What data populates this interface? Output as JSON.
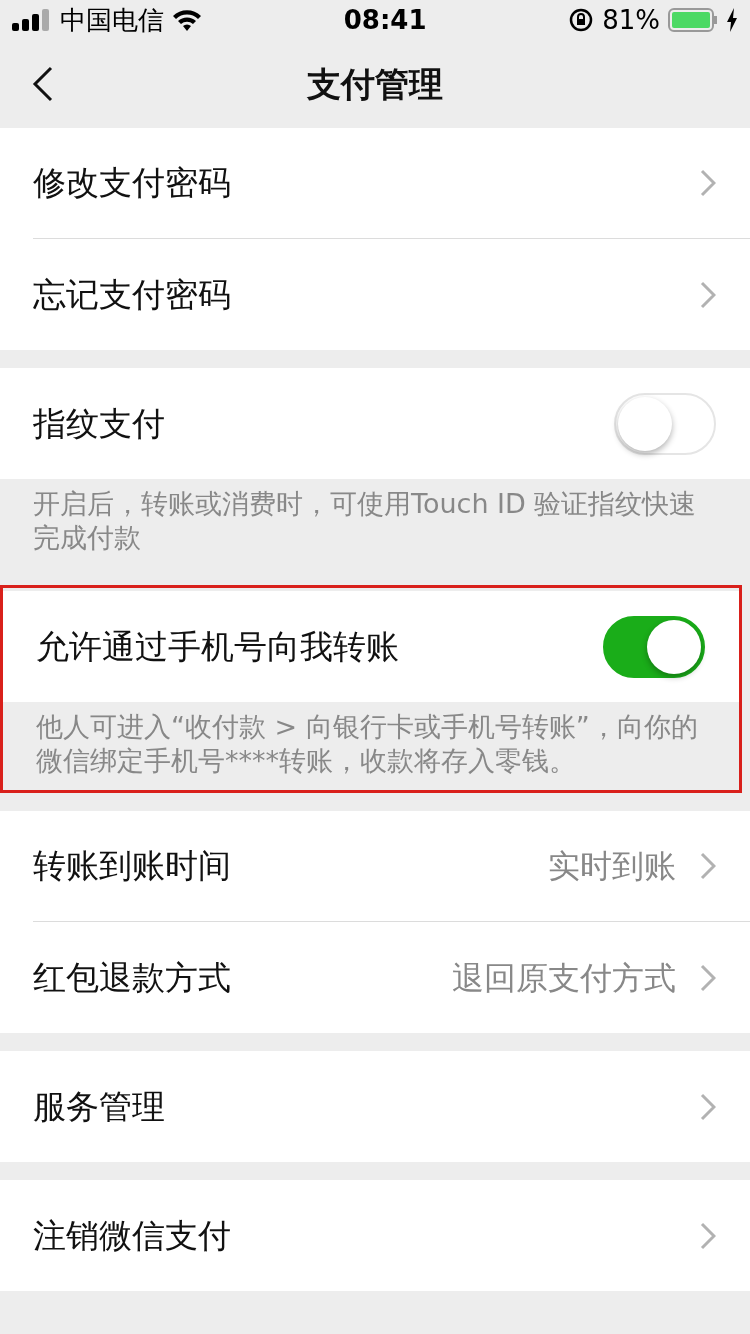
{
  "status_bar": {
    "carrier": "中国电信",
    "time": "08:41",
    "battery": "81%"
  },
  "nav": {
    "title": "支付管理"
  },
  "groups": [
    {
      "items": [
        {
          "kind": "link",
          "label": "修改支付密码"
        },
        {
          "kind": "link",
          "label": "忘记支付密码"
        }
      ]
    },
    {
      "items": [
        {
          "kind": "toggle",
          "label": "指纹支付",
          "on": false
        }
      ],
      "note": "开启后，转账或消费时，可使用Touch ID 验证指纹快速完成付款"
    },
    {
      "highlighted": true,
      "items": [
        {
          "kind": "toggle",
          "label": "允许通过手机号向我转账",
          "on": true
        }
      ],
      "note": "他人可进入“收付款 > 向银行卡或手机号转账”，向你的微信绑定手机号****转账，收款将存入零钱。"
    },
    {
      "items": [
        {
          "kind": "link",
          "label": "转账到账时间",
          "value": "实时到账"
        },
        {
          "kind": "link",
          "label": "红包退款方式",
          "value": "退回原支付方式"
        }
      ]
    },
    {
      "items": [
        {
          "kind": "link",
          "label": "服务管理"
        }
      ]
    },
    {
      "items": [
        {
          "kind": "link",
          "label": "注销微信支付"
        }
      ]
    }
  ]
}
